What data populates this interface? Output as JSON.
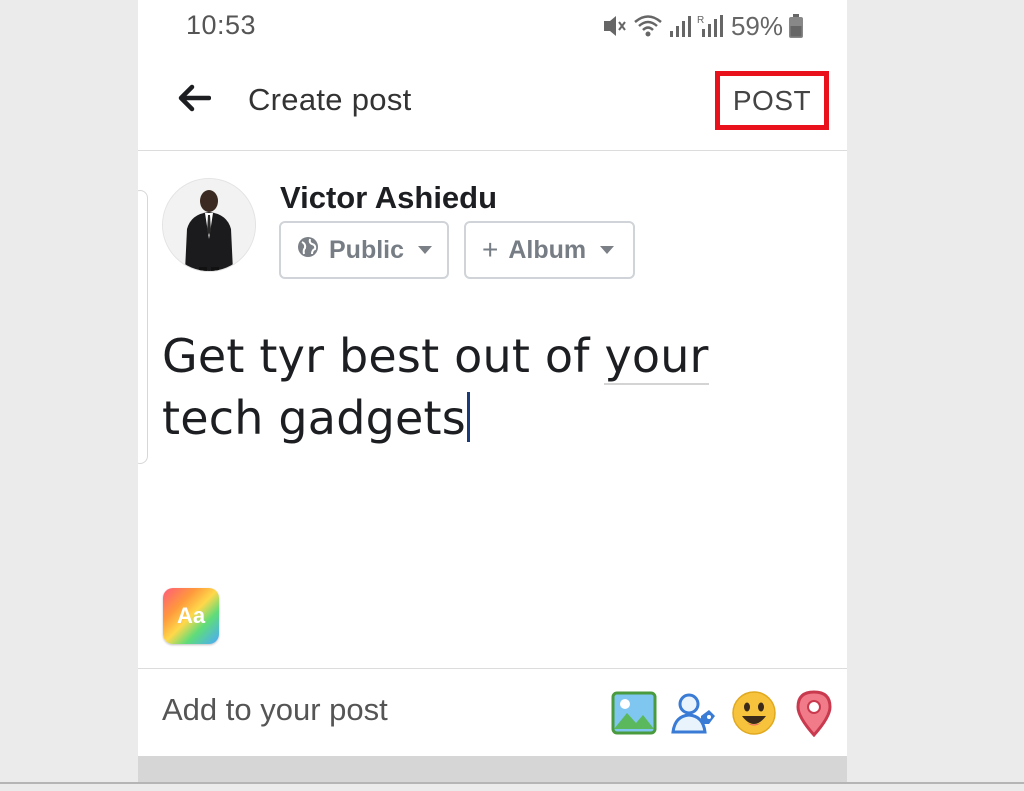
{
  "status_bar": {
    "time": "10:53",
    "battery_percent": "59%",
    "icons": [
      "mute-vibrate-icon",
      "wifi-icon",
      "signal-icon",
      "roaming-signal-icon",
      "battery-icon"
    ]
  },
  "header": {
    "title": "Create post",
    "back_icon": "back-arrow-icon",
    "post_label": "POST",
    "highlight_color": "#e8111c"
  },
  "composer": {
    "user_name": "Victor Ashiedu",
    "privacy_label": "Public",
    "privacy_icon": "globe-icon",
    "album_label": "Album",
    "album_icon": "plus-icon",
    "text_before": "Get tyr best out of ",
    "text_underlined": "your",
    "text_after": " tech gadgets",
    "text_style_label": "Aa"
  },
  "add_to_post": {
    "label": "Add to your post",
    "icons": [
      "photo-icon",
      "tag-people-icon",
      "feeling-emoji-icon",
      "location-pin-icon"
    ]
  }
}
